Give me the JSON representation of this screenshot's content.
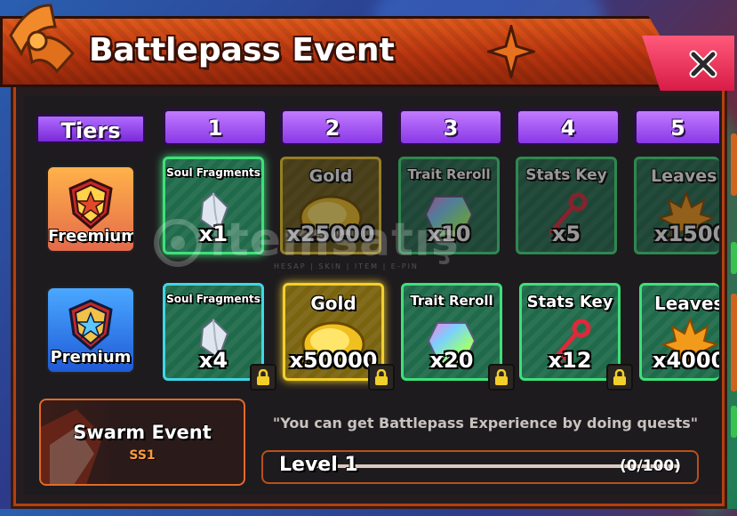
{
  "window": {
    "title": "Battlepass Event",
    "close_icon": "close-x-icon"
  },
  "tiers_label": "Tiers",
  "tier_numbers": [
    "1",
    "2",
    "3",
    "4",
    "5"
  ],
  "tracks": {
    "free": {
      "label": "Freemium",
      "icon": "gold-star-shield-icon"
    },
    "premium": {
      "label": "Premium",
      "icon": "blue-star-shield-icon"
    }
  },
  "free_rewards": [
    {
      "name": "Soul Fragments",
      "qty": "x1",
      "icon": "crystal-shard-icon"
    },
    {
      "name": "Gold",
      "qty": "x25000",
      "icon": "gold-coin-icon"
    },
    {
      "name": "Trait Reroll",
      "qty": "x10",
      "icon": "rainbow-gem-icon"
    },
    {
      "name": "Stats Key",
      "qty": "x5",
      "icon": "red-key-icon"
    },
    {
      "name": "Leaves",
      "qty": "x1500",
      "icon": "maple-leaf-icon"
    }
  ],
  "premium_rewards": [
    {
      "name": "Soul Fragments",
      "qty": "x4",
      "icon": "crystal-shard-icon",
      "locked": true
    },
    {
      "name": "Gold",
      "qty": "x50000",
      "icon": "gold-coin-icon",
      "locked": true
    },
    {
      "name": "Trait Reroll",
      "qty": "x20",
      "icon": "rainbow-gem-icon",
      "locked": true
    },
    {
      "name": "Stats Key",
      "qty": "x12",
      "icon": "red-key-icon",
      "locked": true
    },
    {
      "name": "Leaves",
      "qty": "x4000",
      "icon": "maple-leaf-icon",
      "locked": false
    }
  ],
  "event": {
    "title": "Swarm Event",
    "subtitle": "SS1"
  },
  "hint": "\"You can get Battlepass Experience by doing quests\"",
  "progress": {
    "level": "Level 1",
    "count": "(0/100)",
    "fraction": 0
  },
  "watermark": {
    "text": "itemsatis",
    "tagline": "HESAP | SKIN | ITEM | E-PIN"
  },
  "colors": {
    "title_orange": "#c9420f",
    "tier_purple": "#9b4cf0",
    "reward_green": "#1f6a4a",
    "border_green": "#3ee07a",
    "border_cyan": "#3fd6e6",
    "border_yellow": "#f3cf2a",
    "accent_red": "#e4244e"
  }
}
